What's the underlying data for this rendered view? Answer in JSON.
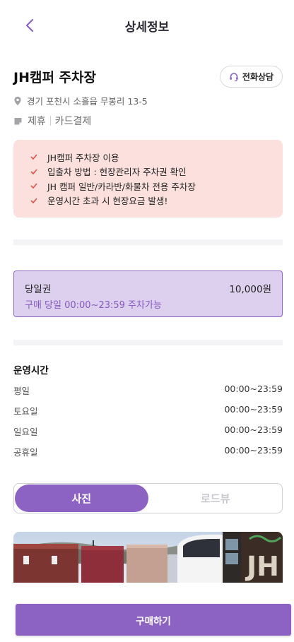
{
  "header": {
    "title": "상세정보",
    "back_icon": "chevron-left-icon"
  },
  "place": {
    "name": "JH캠퍼 주차장",
    "call_button_label": "전화상담",
    "address": "경기 포천시 소흘읍 무봉리 13-5",
    "tags": [
      "제휴",
      "카드결제"
    ]
  },
  "notices": [
    "JH캠퍼 주차장 이용",
    "입출차 방법 : 현장관리자 주차권 확인",
    "JH 캠퍼 일반/카라반/화물차 전용 주차장",
    "운영시간 초과 시 현장요금 발생!"
  ],
  "ticket": {
    "name": "당일권",
    "price": "10,000원",
    "description": "구매 당일 00:00~23:59 주차가능"
  },
  "hours": {
    "title": "운영시간",
    "rows": [
      {
        "day": "평일",
        "time": "00:00~23:59"
      },
      {
        "day": "토요일",
        "time": "00:00~23:59"
      },
      {
        "day": "일요일",
        "time": "00:00~23:59"
      },
      {
        "day": "공휴일",
        "time": "00:00~23:59"
      }
    ]
  },
  "tabs": [
    {
      "label": "사진",
      "active": true
    },
    {
      "label": "로드뷰",
      "active": false
    }
  ],
  "photo": {
    "sign_text": "JH"
  },
  "buy_button_label": "구매하기",
  "colors": {
    "accent": "#8c62c2",
    "notice_bg": "#fbe0dd",
    "ticket_bg": "#ddd0ee",
    "check": "#e0524a"
  }
}
